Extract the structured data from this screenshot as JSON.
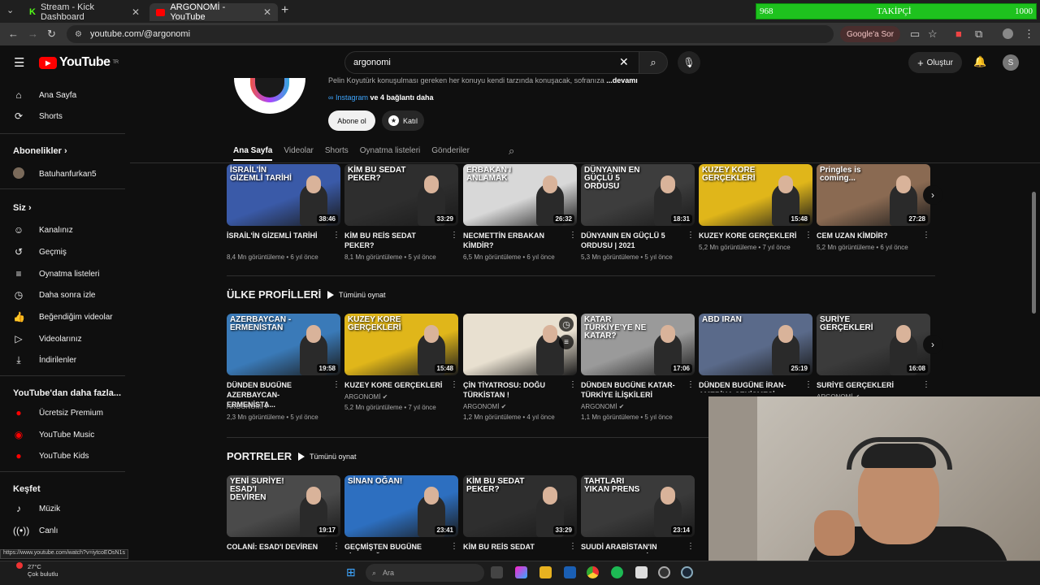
{
  "browser": {
    "tabs": [
      {
        "title": "Stream - Kick Dashboard",
        "active": false
      },
      {
        "title": "ARGONOMİ - YouTube",
        "active": true
      }
    ],
    "url": "youtube.com/@argonomi",
    "google_button": "Google'a Sor",
    "follower_overlay": {
      "current": "968",
      "label": "TAKİPÇİ",
      "goal": "1000",
      "progress": 0.968
    }
  },
  "header": {
    "logo": "YouTube",
    "logo_sup": "TR",
    "search_value": "argonomi",
    "create_label": "Oluştur",
    "avatar_letter": "S"
  },
  "sidebar": {
    "main": [
      {
        "label": "Ana Sayfa",
        "icon": "home-icon"
      },
      {
        "label": "Shorts",
        "icon": "shorts-icon"
      }
    ],
    "subscriptions_title": "Abonelikler",
    "subscriptions": [
      {
        "label": "Batuhanfurkan5"
      }
    ],
    "you_title": "Siz",
    "you": [
      {
        "label": "Kanalınız",
        "icon": "channel-icon"
      },
      {
        "label": "Geçmiş",
        "icon": "history-icon"
      },
      {
        "label": "Oynatma listeleri",
        "icon": "playlist-icon"
      },
      {
        "label": "Daha sonra izle",
        "icon": "watch-later-icon"
      },
      {
        "label": "Beğendiğim videolar",
        "icon": "like-icon"
      },
      {
        "label": "Videolarınız",
        "icon": "video-icon"
      },
      {
        "label": "İndirilenler",
        "icon": "download-icon"
      }
    ],
    "more_title": "YouTube'dan daha fazla...",
    "more": [
      {
        "label": "Ücretsiz Premium"
      },
      {
        "label": "YouTube Music"
      },
      {
        "label": "YouTube Kids"
      }
    ],
    "explore_title": "Keşfet",
    "explore": [
      {
        "label": "Müzik",
        "icon": "music-icon"
      },
      {
        "label": "Canlı",
        "icon": "live-icon"
      }
    ]
  },
  "channel": {
    "description": "Pelin Koyutürk konuşulması gereken her konuyu kendi tarzında konuşacak, sofranıza",
    "more_label": "...devamı",
    "instagram": "Instagram",
    "links_more": "ve 4 bağlantı daha",
    "subscribe_label": "Abone ol",
    "join_label": "Katıl",
    "tabs": [
      "Ana Sayfa",
      "Videolar",
      "Shorts",
      "Oynatma listeleri",
      "Gönderiler"
    ]
  },
  "rows": [
    {
      "videos": [
        {
          "thumb_text": "İSRAİL'İN GİZEMLİ TARİHİ",
          "duration": "38:46",
          "title": "İSRAİL'İN GİZEMLİ TARİHİ",
          "channel": "",
          "meta": "8,4 Mn görüntüleme • 6 yıl önce",
          "color": "#3a5aa8"
        },
        {
          "thumb_text": "KİM BU SEDAT PEKER?",
          "duration": "33:29",
          "title": "KİM BU REİS SEDAT PEKER?",
          "channel": "",
          "meta": "8,1 Mn görüntüleme • 5 yıl önce",
          "color": "#2e2e2e"
        },
        {
          "thumb_text": "ERBAKAN'I ANLAMAK",
          "duration": "26:32",
          "title": "NECMETTİN ERBAKAN KİMDİR?",
          "channel": "",
          "meta": "6,5 Mn görüntüleme • 6 yıl önce",
          "color": "#d8d8d8"
        },
        {
          "thumb_text": "DÜNYANIN EN GÜÇLÜ 5 ORDUSU",
          "duration": "18:31",
          "title": "DÜNYANIN EN GÜÇLÜ 5 ORDUSU | 2021",
          "channel": "",
          "meta": "5,3 Mn görüntüleme • 5 yıl önce",
          "color": "#3d3d3d"
        },
        {
          "thumb_text": "KUZEY KORE GERÇEKLERİ",
          "duration": "15:48",
          "title": "KUZEY KORE GERÇEKLERİ",
          "channel": "",
          "meta": "5,2 Mn görüntüleme • 7 yıl önce",
          "color": "#e0b61a"
        },
        {
          "thumb_text": "Pringles is coming...",
          "duration": "27:28",
          "title": "CEM UZAN KİMDİR?",
          "channel": "",
          "meta": "5,2 Mn görüntüleme • 6 yıl önce",
          "color": "#8a6a52"
        }
      ]
    },
    {
      "section_title": "ÜLKE PROFİLLERİ",
      "play_all": "Tümünü oynat",
      "videos": [
        {
          "thumb_text": "AZERBAYCAN - ERMENİSTAN",
          "duration": "19:58",
          "title": "DÜNDEN BUGÜNE AZERBAYCAN-ERMENİSTA...",
          "channel": "ARGONOMİ",
          "meta": "2,3 Mn görüntüleme • 5 yıl önce",
          "color": "#3a7ab8"
        },
        {
          "thumb_text": "KUZEY KORE GERÇEKLERİ",
          "duration": "15:48",
          "title": "KUZEY KORE GERÇEKLERİ",
          "channel": "ARGONOMİ",
          "meta": "5,2 Mn görüntüleme • 7 yıl önce",
          "color": "#e0b61a"
        },
        {
          "thumb_text": "",
          "duration": "",
          "title": "ÇİN TİYATROSU: DOĞU TÜRKİSTAN !",
          "channel": "ARGONOMİ",
          "meta": "1,2 Mn görüntüleme • 4 yıl önce",
          "color": "#e8e0d0"
        },
        {
          "thumb_text": "KATAR TÜRKİYE'YE NE KATAR?",
          "duration": "17:06",
          "title": "DÜNDEN BUGÜNE KATAR-TÜRKİYE İLİŞKİLERİ",
          "channel": "ARGONOMİ",
          "meta": "1,1 Mn görüntüleme • 5 yıl önce",
          "color": "#9a9a9a"
        },
        {
          "thumb_text": "ABD IRAN",
          "duration": "25:19",
          "title": "DÜNDEN BUGÜNE İRAN-AMERİKA ÇEKİŞMESİ",
          "channel": "",
          "meta": "",
          "color": "#5a6a8a"
        },
        {
          "thumb_text": "SURİYE GERÇEKLERİ",
          "duration": "16:08",
          "title": "SURİYE GERÇEKLERİ",
          "channel": "ARGONOMİ",
          "meta": "",
          "color": "#3b3b3b"
        }
      ]
    },
    {
      "section_title": "PORTRELER",
      "play_all": "Tümünü oynat",
      "videos": [
        {
          "thumb_text": "YENİ SURİYE! ESAD'I DEVİREN",
          "duration": "19:17",
          "title": "COLANİ: ESAD'I DEVİREN ADAM!",
          "channel": "",
          "meta": "",
          "color": "#4a4a4a"
        },
        {
          "thumb_text": "SİNAN OĞAN!",
          "duration": "23:41",
          "title": "GEÇMİŞTEN BUGÜNE SİNAN OĞAN",
          "channel": "",
          "meta": "",
          "color": "#2d6fc0"
        },
        {
          "thumb_text": "KİM BU SEDAT PEKER?",
          "duration": "33:29",
          "title": "KİM BU REİS SEDAT PEKER?",
          "channel": "",
          "meta": "",
          "color": "#2e2e2e"
        },
        {
          "thumb_text": "TAHTLARI YIKAN PRENS",
          "duration": "23:14",
          "title": "SUUDİ ARABİSTAN'IN KARANLIK PRENSİ",
          "channel": "",
          "meta": "",
          "color": "#3a3a3a"
        }
      ]
    }
  ],
  "status_url": "https://www.youtube.com/watch?v=iytcoEOsN1s",
  "taskbar": {
    "temperature": "27°C",
    "weather": "Çok bulutlu",
    "search_placeholder": "Ara"
  }
}
